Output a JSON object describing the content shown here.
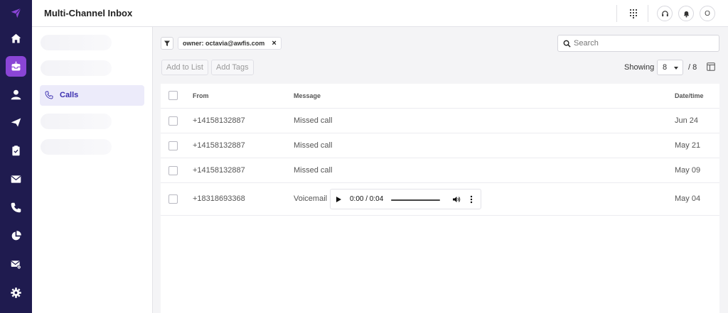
{
  "header": {
    "title": "Multi-Channel Inbox",
    "user_initial": "O"
  },
  "rail": {
    "icons": [
      "logo-icon",
      "home-icon",
      "inbox-icon",
      "contacts-icon",
      "campaign-icon",
      "tasks-icon",
      "mail-icon",
      "phone-icon",
      "reports-icon",
      "mail-settings-icon",
      "settings-icon"
    ],
    "active": "inbox-icon",
    "active_color": "#8a45d6",
    "bg_color": "#1f1b4f"
  },
  "subnav": {
    "active_item": {
      "label": "Calls",
      "icon": "phone-icon"
    }
  },
  "filters": {
    "chip_label": "owner: octavia@awfis.com",
    "chip_remove": "×"
  },
  "search": {
    "placeholder": "Search"
  },
  "actions": {
    "add_to_list": "Add to List",
    "add_tags": "Add Tags"
  },
  "pagination": {
    "showing_label": "Showing",
    "page_size": "8",
    "total_label": "/ 8"
  },
  "table": {
    "headers": {
      "from": "From",
      "message": "Message",
      "datetime": "Date/time"
    },
    "rows": [
      {
        "from": "+14158132887",
        "message": "Missed call",
        "date": "Jun 24"
      },
      {
        "from": "+14158132887",
        "message": "Missed call",
        "date": "May 21"
      },
      {
        "from": "+14158132887",
        "message": "Missed call",
        "date": "May 09"
      },
      {
        "from": "+18318693368",
        "message": "Voicemail",
        "date": "May 04",
        "audio": {
          "time": "0:00 / 0:04"
        }
      }
    ]
  }
}
